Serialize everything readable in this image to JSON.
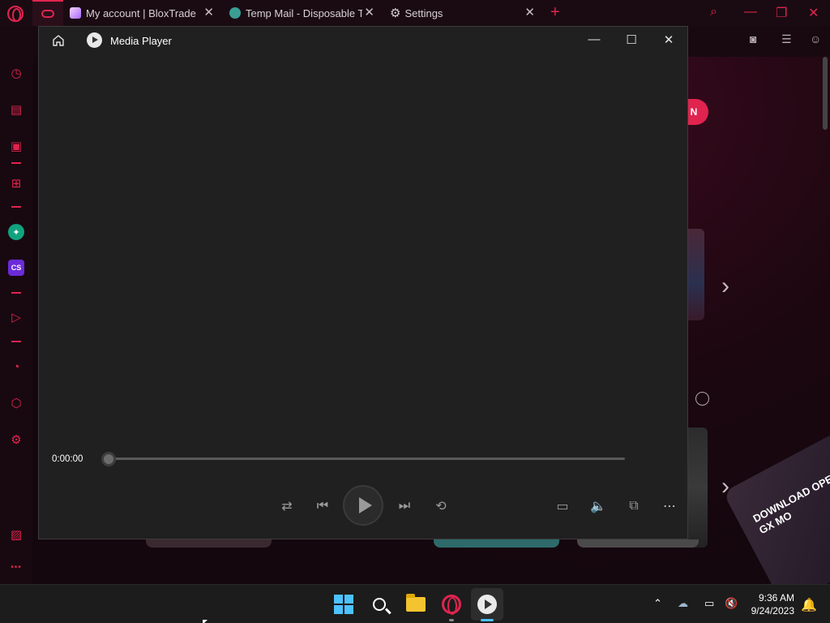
{
  "browser": {
    "tabs": [
      {
        "title": "My account | BloxTrade",
        "close": "✕"
      },
      {
        "title": "Temp Mail - Disposable Ter",
        "close": "✕"
      },
      {
        "title": "Settings",
        "close": "✕"
      }
    ],
    "new_tab": "+",
    "join_button": "N",
    "promo_text": "DOWNLOAD OPERA GX MO",
    "accent_color": "#e0244f"
  },
  "sidebar": {
    "items": [
      "speed-dial",
      "shopping",
      "twitch",
      "gx-control",
      "chatgpt",
      "cs",
      "player",
      "history",
      "extensions",
      "settings",
      "pinboard",
      "more"
    ],
    "chatgpt_label": "✦",
    "cs_label": "CS",
    "more_label": "•••"
  },
  "media_player": {
    "title": "Media Player",
    "current_time": "0:00:00",
    "progress": 0.0,
    "controls": [
      "shuffle",
      "previous",
      "play",
      "next",
      "repeat",
      "subtitles",
      "volume",
      "mini-view",
      "more"
    ]
  },
  "taskbar": {
    "apps": [
      "start",
      "search",
      "file-explorer",
      "opera-gx",
      "media-player"
    ],
    "time": "9:36 AM",
    "date": "9/24/2023"
  }
}
